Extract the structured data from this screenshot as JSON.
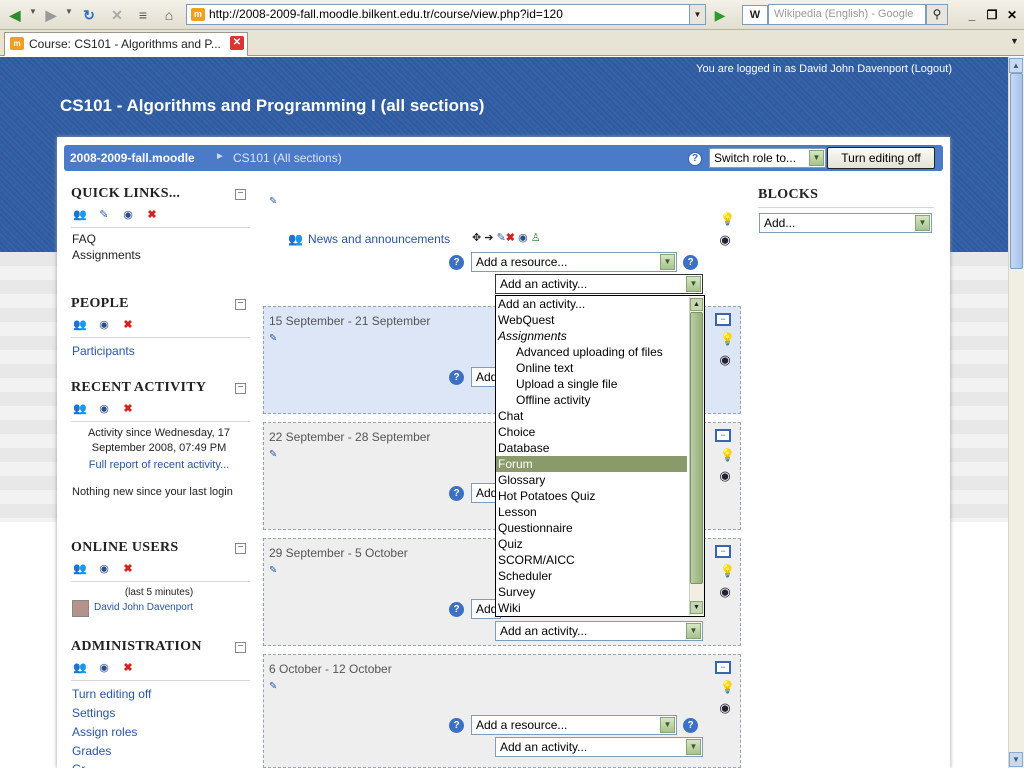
{
  "browser": {
    "url": "http://2008-2009-fall.moodle.bilkent.edu.tr/course/view.php?id=120",
    "search_placeholder": "Wikipedia (English) - Google",
    "tab_title": "Course: CS101 - Algorithms and P..."
  },
  "header": {
    "login_info": "You are logged in as David John Davenport (Logout)",
    "course_title": "CS101 - Algorithms and Programming I (all sections)"
  },
  "navbar": {
    "site": "2008-2009-fall.moodle",
    "separator": "►",
    "course": "CS101 (All sections)",
    "switch_role": "Switch role to...",
    "editing_button": "Turn editing off"
  },
  "left": {
    "quick_links": {
      "title": "QUICK LINKS...",
      "items": [
        "FAQ",
        "Assignments"
      ]
    },
    "people": {
      "title": "PEOPLE",
      "link": "Participants"
    },
    "recent": {
      "title": "RECENT ACTIVITY",
      "since_line1": "Activity since Wednesday, 17",
      "since_line2": "September 2008, 07:49 PM",
      "full_report": "Full report of recent activity...",
      "nothing": "Nothing new since your last login"
    },
    "online": {
      "title": "ONLINE USERS",
      "note": "(last 5 minutes)",
      "user": "David John Davenport"
    },
    "admin": {
      "title": "ADMINISTRATION",
      "items": [
        "Turn editing off",
        "Settings",
        "Assign roles",
        "Grades",
        "Gr..."
      ]
    }
  },
  "main": {
    "news": "News and announcements",
    "add_resource": "Add a resource...",
    "add_activity": "Add an activity...",
    "add_short": "Add",
    "weeks": [
      "15 September - 21 September",
      "22 September - 28 September",
      "29 September - 5 October",
      "6 October - 12 October"
    ]
  },
  "dropdown": {
    "options": [
      {
        "label": "Add an activity...",
        "type": "opt"
      },
      {
        "label": "WebQuest",
        "type": "opt"
      },
      {
        "label": "Assignments",
        "type": "group"
      },
      {
        "label": "Advanced uploading of files",
        "type": "sub"
      },
      {
        "label": "Online text",
        "type": "sub"
      },
      {
        "label": "Upload a single file",
        "type": "sub"
      },
      {
        "label": "Offline activity",
        "type": "sub"
      },
      {
        "label": "Chat",
        "type": "opt"
      },
      {
        "label": "Choice",
        "type": "opt"
      },
      {
        "label": "Database",
        "type": "opt"
      },
      {
        "label": "Forum",
        "type": "selected"
      },
      {
        "label": "Glossary",
        "type": "opt"
      },
      {
        "label": "Hot Potatoes Quiz",
        "type": "opt"
      },
      {
        "label": "Lesson",
        "type": "opt"
      },
      {
        "label": "Questionnaire",
        "type": "opt"
      },
      {
        "label": "Quiz",
        "type": "opt"
      },
      {
        "label": "SCORM/AICC",
        "type": "opt"
      },
      {
        "label": "Scheduler",
        "type": "opt"
      },
      {
        "label": "Survey",
        "type": "opt"
      },
      {
        "label": "Wiki",
        "type": "opt"
      }
    ]
  },
  "right": {
    "title": "BLOCKS",
    "add": "Add..."
  },
  "icons": {
    "back": "back-arrow-icon",
    "forward": "forward-arrow-icon",
    "refresh": "refresh-icon",
    "stop": "stop-icon",
    "home": "home-icon",
    "help": "help-icon",
    "eye": "eye-icon",
    "delete": "delete-icon",
    "edit": "edit-icon",
    "lightbulb": "lightbulb-icon"
  }
}
